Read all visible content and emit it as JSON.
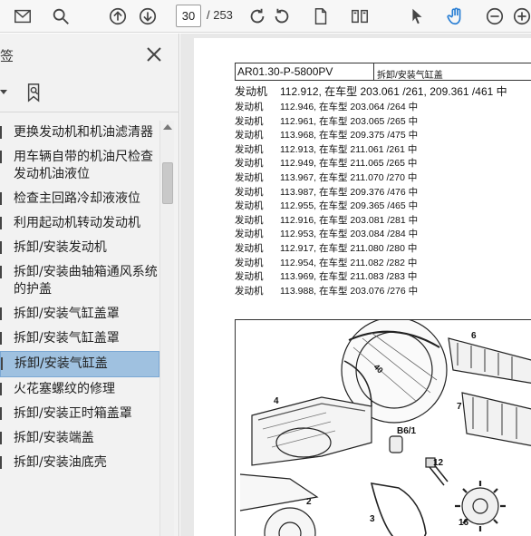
{
  "toolbar": {
    "page_current": "30",
    "page_total": "/ 253"
  },
  "sidebar": {
    "title": "签",
    "items": [
      {
        "label": "更换发动机和机油滤清器"
      },
      {
        "label": "用车辆自带的机油尺检查发动机油液位"
      },
      {
        "label": "检查主回路冷却液液位"
      },
      {
        "label": "利用起动机转动发动机"
      },
      {
        "label": "拆卸/安装发动机"
      },
      {
        "label": "拆卸/安装曲轴箱通风系统的护盖"
      },
      {
        "label": "拆卸/安装气缸盖罩"
      },
      {
        "label": "拆卸/安装气缸盖罩"
      },
      {
        "label": "拆卸/安装气缸盖",
        "selected": true
      },
      {
        "label": "火花塞螺纹的修理"
      },
      {
        "label": "拆卸/安装正时箱盖罩"
      },
      {
        "label": "拆卸/安装端盖"
      },
      {
        "label": "拆卸/安装油底壳"
      }
    ]
  },
  "document": {
    "header_code": "AR01.30-P-5800PV",
    "header_title": "拆卸/安装气缸盖",
    "rows": [
      {
        "k": "发动机",
        "v": "112.912, 在车型 203.061 /261, 209.361 /461 中"
      },
      {
        "k": "发动机",
        "v": "112.946, 在车型 203.064 /264 中"
      },
      {
        "k": "发动机",
        "v": "112.961, 在车型 203.065 /265 中"
      },
      {
        "k": "发动机",
        "v": "113.968, 在车型 209.375 /475 中"
      },
      {
        "k": "发动机",
        "v": "112.913, 在车型 211.061 /261 中"
      },
      {
        "k": "发动机",
        "v": "112.949, 在车型 211.065 /265 中"
      },
      {
        "k": "发动机",
        "v": "113.967, 在车型 211.070 /270 中"
      },
      {
        "k": "发动机",
        "v": "113.987, 在车型 209.376 /476 中"
      },
      {
        "k": "发动机",
        "v": "112.955, 在车型 209.365 /465 中"
      },
      {
        "k": "发动机",
        "v": "112.916, 在车型 203.081 /281 中"
      },
      {
        "k": "发动机",
        "v": "112.953, 在车型 203.084 /284 中"
      },
      {
        "k": "发动机",
        "v": "112.917, 在车型 211.080 /280 中"
      },
      {
        "k": "发动机",
        "v": "112.954, 在车型 211.082 /282 中"
      },
      {
        "k": "发动机",
        "v": "113.969, 在车型 211.083 /283 中"
      },
      {
        "k": "发动机",
        "v": "113.988, 在车型 203.076 /276 中"
      }
    ],
    "diagram_labels": [
      "4",
      "6",
      "7",
      "B6/1",
      "12",
      "2",
      "3",
      "16",
      "40"
    ]
  },
  "icons": [
    "mail-icon",
    "search-icon",
    "arrow-up-circle-icon",
    "arrow-down-circle-icon",
    "rotate-cw-icon",
    "rotate-ccw-icon",
    "page-icon",
    "two-page-icon",
    "pointer-icon",
    "hand-icon",
    "zoom-out-icon",
    "zoom-in-icon",
    "close-icon",
    "expand-icon",
    "bookmark-icon"
  ]
}
